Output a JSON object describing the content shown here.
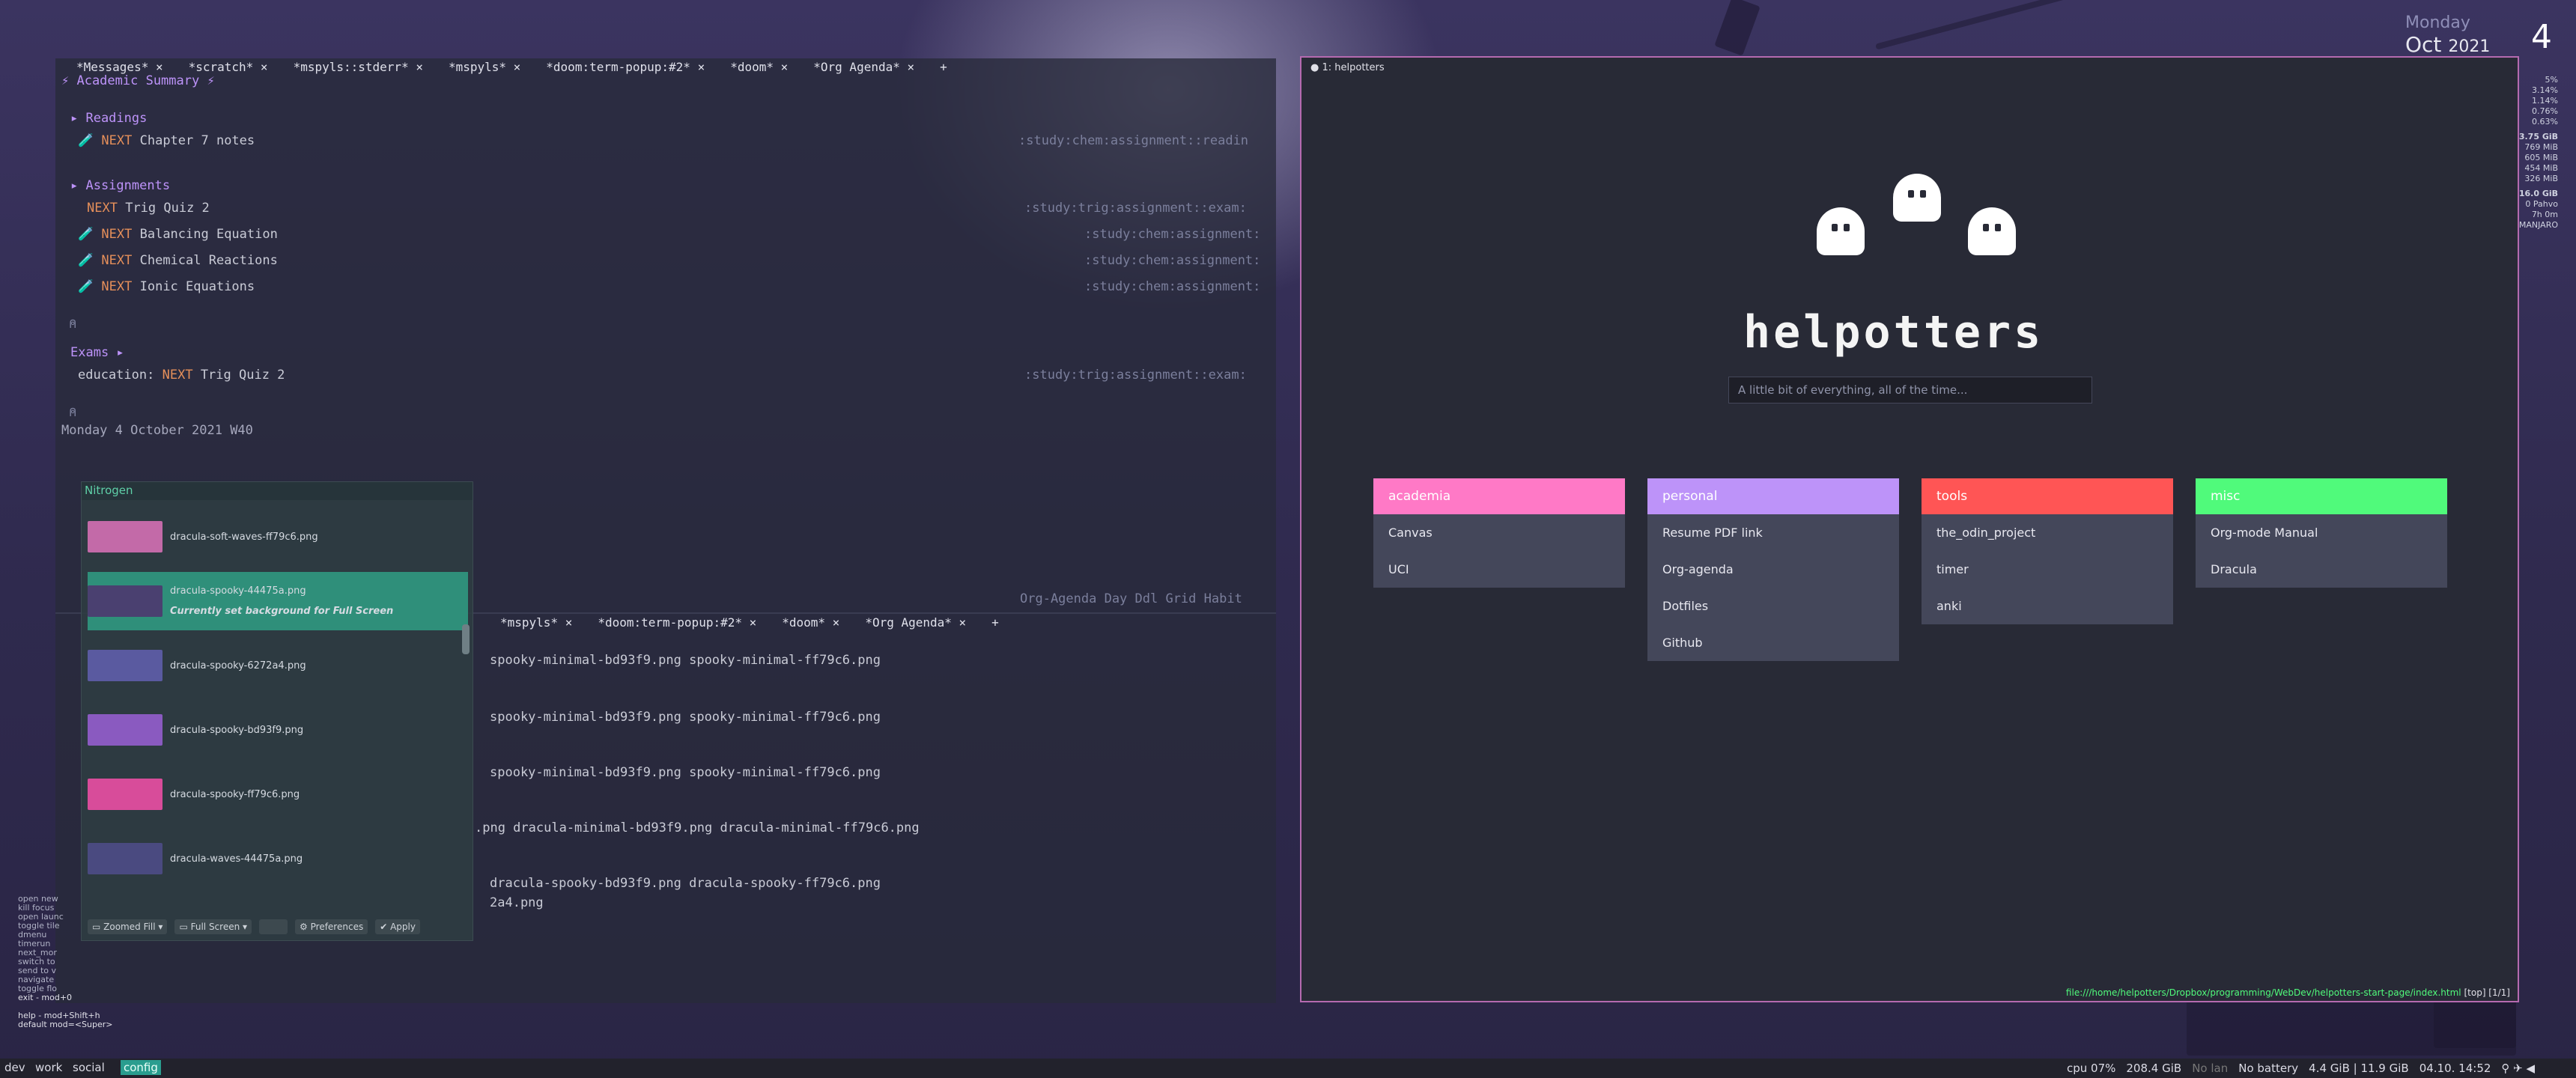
{
  "emacs": {
    "tabs": [
      "*Messages* ×",
      "*scratch* ×",
      "*mspyls::stderr* ×",
      "*mspyls* ×",
      "*doom:term-popup:#2* ×",
      "*doom* ×",
      "*Org Agenda* ×",
      "+"
    ],
    "header": "⚡ Academic Summary ⚡",
    "readings": {
      "heading": "▸ Readings",
      "item": {
        "kw": "NEXT",
        "title": "Chapter 7 notes",
        "tags": ":study:chem:assignment::readin"
      }
    },
    "assignments": {
      "heading": "▸ Assignments",
      "items": [
        {
          "kw": "NEXT",
          "title": "Trig Quiz 2",
          "tags": ":study:trig:assignment::exam:"
        },
        {
          "kw": "NEXT",
          "title": "Balancing Equation",
          "tags": ":study:chem:assignment:"
        },
        {
          "kw": "NEXT",
          "title": "Chemical Reactions",
          "tags": ":study:chem:assignment:"
        },
        {
          "kw": "NEXT",
          "title": "Ionic Equations",
          "tags": ":study:chem:assignment:"
        }
      ]
    },
    "exams": {
      "heading": "Exams ▸",
      "prefix": "education:",
      "kw": "NEXT",
      "title": "Trig Quiz 2",
      "tags": ":study:trig:assignment::exam:"
    },
    "date_line": {
      "day": "Monday",
      "date": "4 October 2021 W40"
    },
    "agenda_footer": "Org-Agenda Day Ddl Grid Habit",
    "tabs2": [
      "*mspyls* ×",
      "*doom:term-popup:#2* ×",
      "*doom* ×",
      "*Org Agenda* ×",
      "+"
    ],
    "terminal_lines": [
      "spooky-minimal-bd93f9.png  spooky-minimal-ff79c6.png",
      "spooky-minimal-bd93f9.png  spooky-minimal-ff79c6.png",
      "spooky-minimal-bd93f9.png  spooky-minimal-ff79c6.png",
      ".png  dracula-minimal-bd93f9.png  dracula-minimal-ff79c6.png",
      "dracula-spooky-bd93f9.png  dracula-spooky-ff79c6.png",
      "2a4.png"
    ]
  },
  "nitrogen": {
    "title": "Nitrogen",
    "items": [
      {
        "name": "dracula-soft-waves-ff79c6.png",
        "note": ""
      },
      {
        "name": "dracula-spooky-44475a.png",
        "note": "Currently set background for Full Screen"
      },
      {
        "name": "dracula-spooky-6272a4.png",
        "note": ""
      },
      {
        "name": "dracula-spooky-bd93f9.png",
        "note": ""
      },
      {
        "name": "dracula-spooky-ff79c6.png",
        "note": ""
      },
      {
        "name": "dracula-waves-44475a.png",
        "note": ""
      }
    ],
    "buttons": {
      "mode": "Zoomed Fill",
      "screen": "Full Screen",
      "prefs": "Preferences",
      "apply": "Apply"
    }
  },
  "browser": {
    "tab_title": "1: helpotters",
    "logo_text": "helpotters",
    "search_placeholder": "A little bit of everything, all of the time...",
    "cards": [
      {
        "title": "academia",
        "color": "#ff79c6",
        "items": [
          "Canvas",
          "UCI"
        ]
      },
      {
        "title": "personal",
        "color": "#bd93f9",
        "items": [
          "Resume PDF link",
          "Org-agenda",
          "Dotfiles",
          "Github"
        ]
      },
      {
        "title": "tools",
        "color": "#ff5555",
        "items": [
          "the_odin_project",
          "timer",
          "anki"
        ]
      },
      {
        "title": "misc",
        "color": "#50fa7b",
        "items": [
          "Org-mode Manual",
          "Dracula"
        ]
      }
    ],
    "url": "file:///home/helpotters/Dropbox/programming/WebDev/helpotters-start-page/index.html",
    "url_suffix": "[top] [1/1]"
  },
  "desktop": {
    "weekday": "Monday",
    "month": "Oct",
    "year": "2021",
    "day": "4",
    "sys": [
      "5%",
      "3.14%",
      "1.14%",
      "0.76%",
      "0.63%",
      "3.75 GiB",
      "769 MiB",
      "605 MiB",
      "454 MiB",
      "326 MiB",
      "16.0 GiB",
      "0 Pahvo",
      "7h 0m",
      "MANJARO"
    ],
    "keybinds": [
      "open new",
      "kill focus",
      "open launc",
      "toggle tile",
      "dmenu",
      "timerun",
      "next_mor",
      "switch to",
      "send to v",
      "navigate",
      "toggle flo",
      "exit - mod+0",
      "help - mod+Shift+h",
      "default mod=<Super>"
    ]
  },
  "statusbar": {
    "workspaces": [
      "dev",
      "work",
      "social",
      "config"
    ],
    "active": "config",
    "cpu": "cpu  07%",
    "disk": "208.4 GiB",
    "net": "No lan",
    "battery": "No battery",
    "mem": "4.4 GiB | 11.9 GiB",
    "datetime": "04.10. 14:52"
  }
}
